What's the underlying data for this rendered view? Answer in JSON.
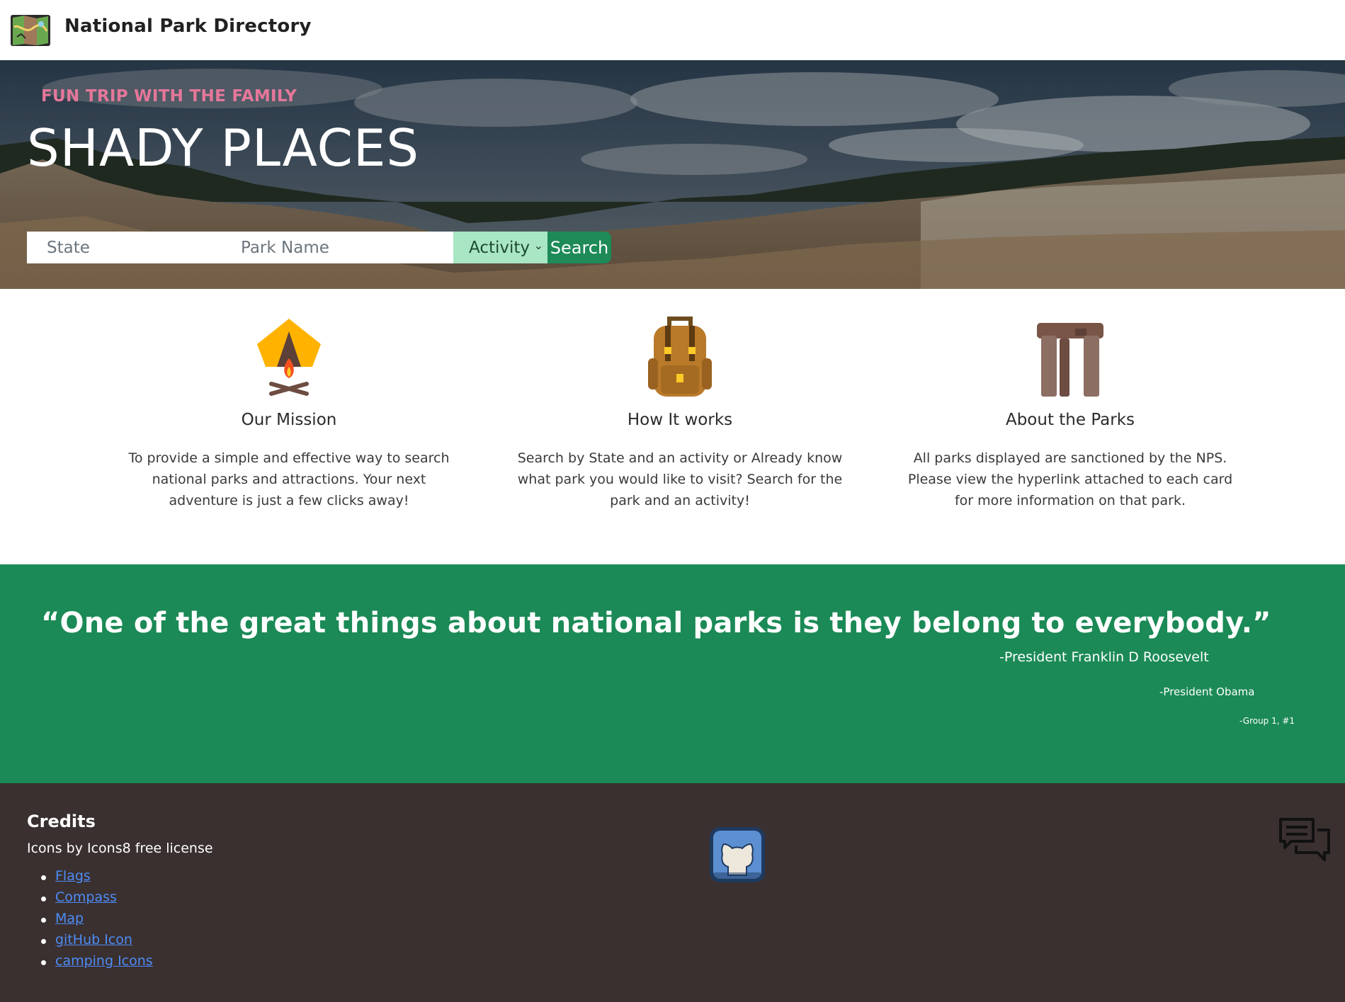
{
  "header": {
    "brand": "National Park Directory",
    "logo_icon": "folded-map-icon"
  },
  "hero": {
    "kicker": "FUN TRIP WITH THE FAMILY",
    "title": "SHADY PLACES",
    "search": {
      "state_placeholder": "State",
      "park_placeholder": "Park Name",
      "activity_selected": "Activity",
      "button_label": "Search"
    },
    "background": "canyon-landscape-photo"
  },
  "features": [
    {
      "icon": "campfire-tent-icon",
      "title": "Our Mission",
      "text": "To provide a simple and effective way to search national parks and attractions. Your next adventure is just a few clicks away!"
    },
    {
      "icon": "backpack-icon",
      "title": "How It works",
      "text": "Search by State and an activity or Already know what park you would like to visit? Search for the park and an activity!"
    },
    {
      "icon": "stonehenge-icon",
      "title": "About the Parks",
      "text": "All parks displayed are sanctioned by the NPS. Please view the hyperlink attached to each card for more information on that park."
    }
  ],
  "quote": {
    "text": "“One of the great things about national parks is they belong to everybody.”",
    "attributions": [
      "-President Franklin D Roosevelt",
      "-President Obama",
      "-Group 1, #1"
    ]
  },
  "footer": {
    "credits_title": "Credits",
    "credits_subtitle": "Icons by Icons8 free license",
    "links": [
      "Flags",
      "Compass",
      "Map",
      "gitHub Icon",
      "camping Icons"
    ],
    "github_icon": "github-icon",
    "chat_icon": "chat-bubbles-icon"
  },
  "colors": {
    "kicker": "#e5779a",
    "quote_bg": "#1b8a56",
    "footer_bg": "#3a3030",
    "search_button": "#1d8a57",
    "activity_select": "#a8e6c4",
    "link": "#4d8cf5"
  }
}
